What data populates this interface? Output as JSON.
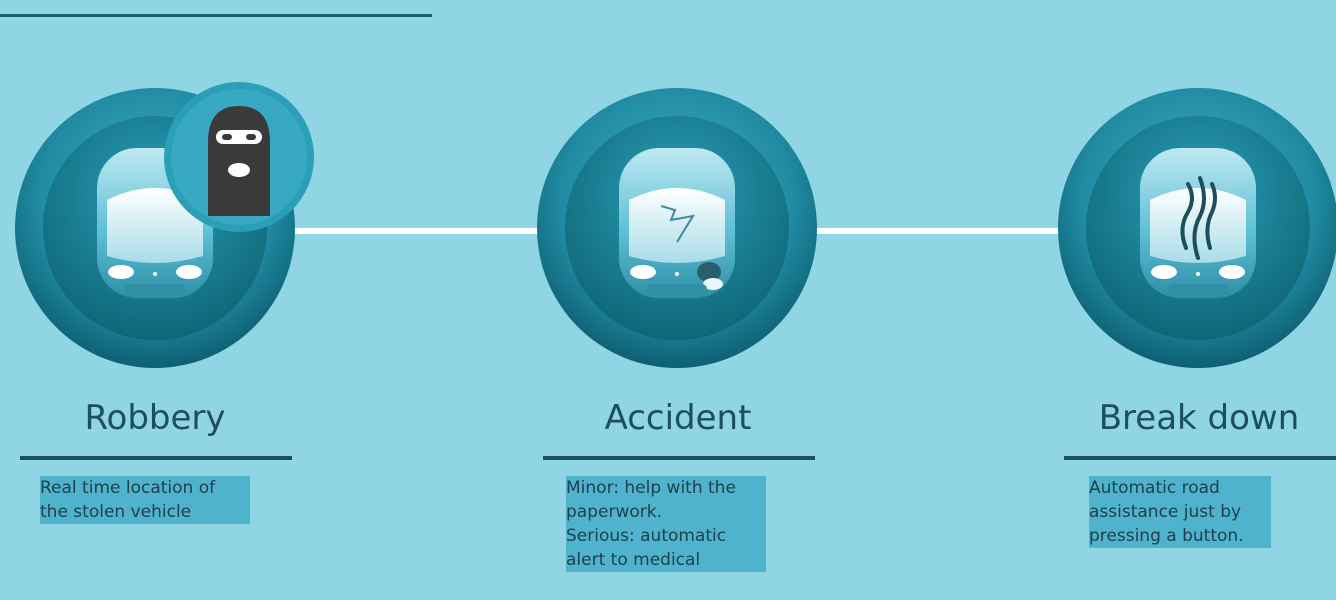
{
  "steps": [
    {
      "id": "robbery",
      "title": "Robbery",
      "description_lines": [
        "Real time location of",
        "the stolen vehicle"
      ]
    },
    {
      "id": "accident",
      "title": "Accident",
      "description_lines": [
        "Minor: help with the",
        "paperwork.",
        "Serious: automatic",
        "alert to medical"
      ]
    },
    {
      "id": "breakdown",
      "title": "Break down",
      "description_lines": [
        "Automatic road",
        "assistance just by",
        "pressing a button."
      ]
    }
  ],
  "colors": {
    "background": "#8fd5e4",
    "dark_text": "#1d4e5c",
    "highlight": "#4fb3cd",
    "ring_dark": "#0f6678",
    "ring_light": "#38a9c1"
  },
  "icons": [
    "balaclava-icon",
    "car-icon",
    "windshield-crack-icon",
    "smoke-icon"
  ]
}
